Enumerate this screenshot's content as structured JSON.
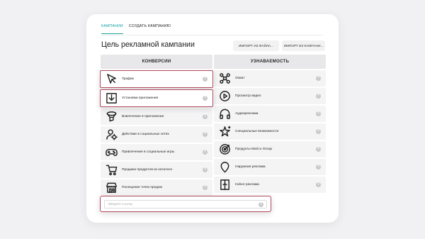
{
  "tabs": [
    {
      "label": "Кампании",
      "active": true
    },
    {
      "label": "Создать кампанию",
      "active": false
    }
  ],
  "title": "Цель рекламной кампании",
  "import_buttons": {
    "file": "Импорт из файла...",
    "campaign": "Импорт из кампани..."
  },
  "columns": [
    {
      "header": "Конверсии",
      "items": [
        {
          "label": "Трафик",
          "icon": "cursor-icon",
          "selected": true
        },
        {
          "label": "Установки приложения",
          "icon": "download-icon",
          "selected": true
        },
        {
          "label": "Вовлечение в приложение",
          "icon": "funnel-icon",
          "selected": false
        },
        {
          "label": "Действие в социальных сетях",
          "icon": "user-gear-icon",
          "selected": false
        },
        {
          "label": "Привлечение в социальные игры",
          "icon": "gamepad-icon",
          "selected": false
        },
        {
          "label": "Продажи продуктов из каталога",
          "icon": "cart-icon",
          "selected": false
        },
        {
          "label": "Посещение точек продаж",
          "icon": "store-icon",
          "selected": false
        }
      ]
    },
    {
      "header": "Узнаваемость",
      "items": [
        {
          "label": "Охват",
          "icon": "network-icon",
          "selected": false
        },
        {
          "label": "Просмотр видео",
          "icon": "video-icon",
          "selected": false
        },
        {
          "label": "Аудиореклама",
          "icon": "headphones-icon",
          "selected": false
        },
        {
          "label": "Специальные возможности",
          "icon": "stars-icon",
          "selected": false
        },
        {
          "label": "Продукты Mail.ru Group",
          "icon": "target-icon",
          "selected": false
        },
        {
          "label": "Наружная реклама",
          "icon": "location-pin-icon",
          "selected": false
        },
        {
          "label": "Indoor реклама",
          "icon": "door-icon",
          "selected": false
        }
      ]
    }
  ],
  "url_input": {
    "placeholder": "Введите ссылку"
  },
  "colors": {
    "accent": "#1aa1a4",
    "highlight": "#b1495d",
    "row_bg": "#f4f4f5"
  }
}
